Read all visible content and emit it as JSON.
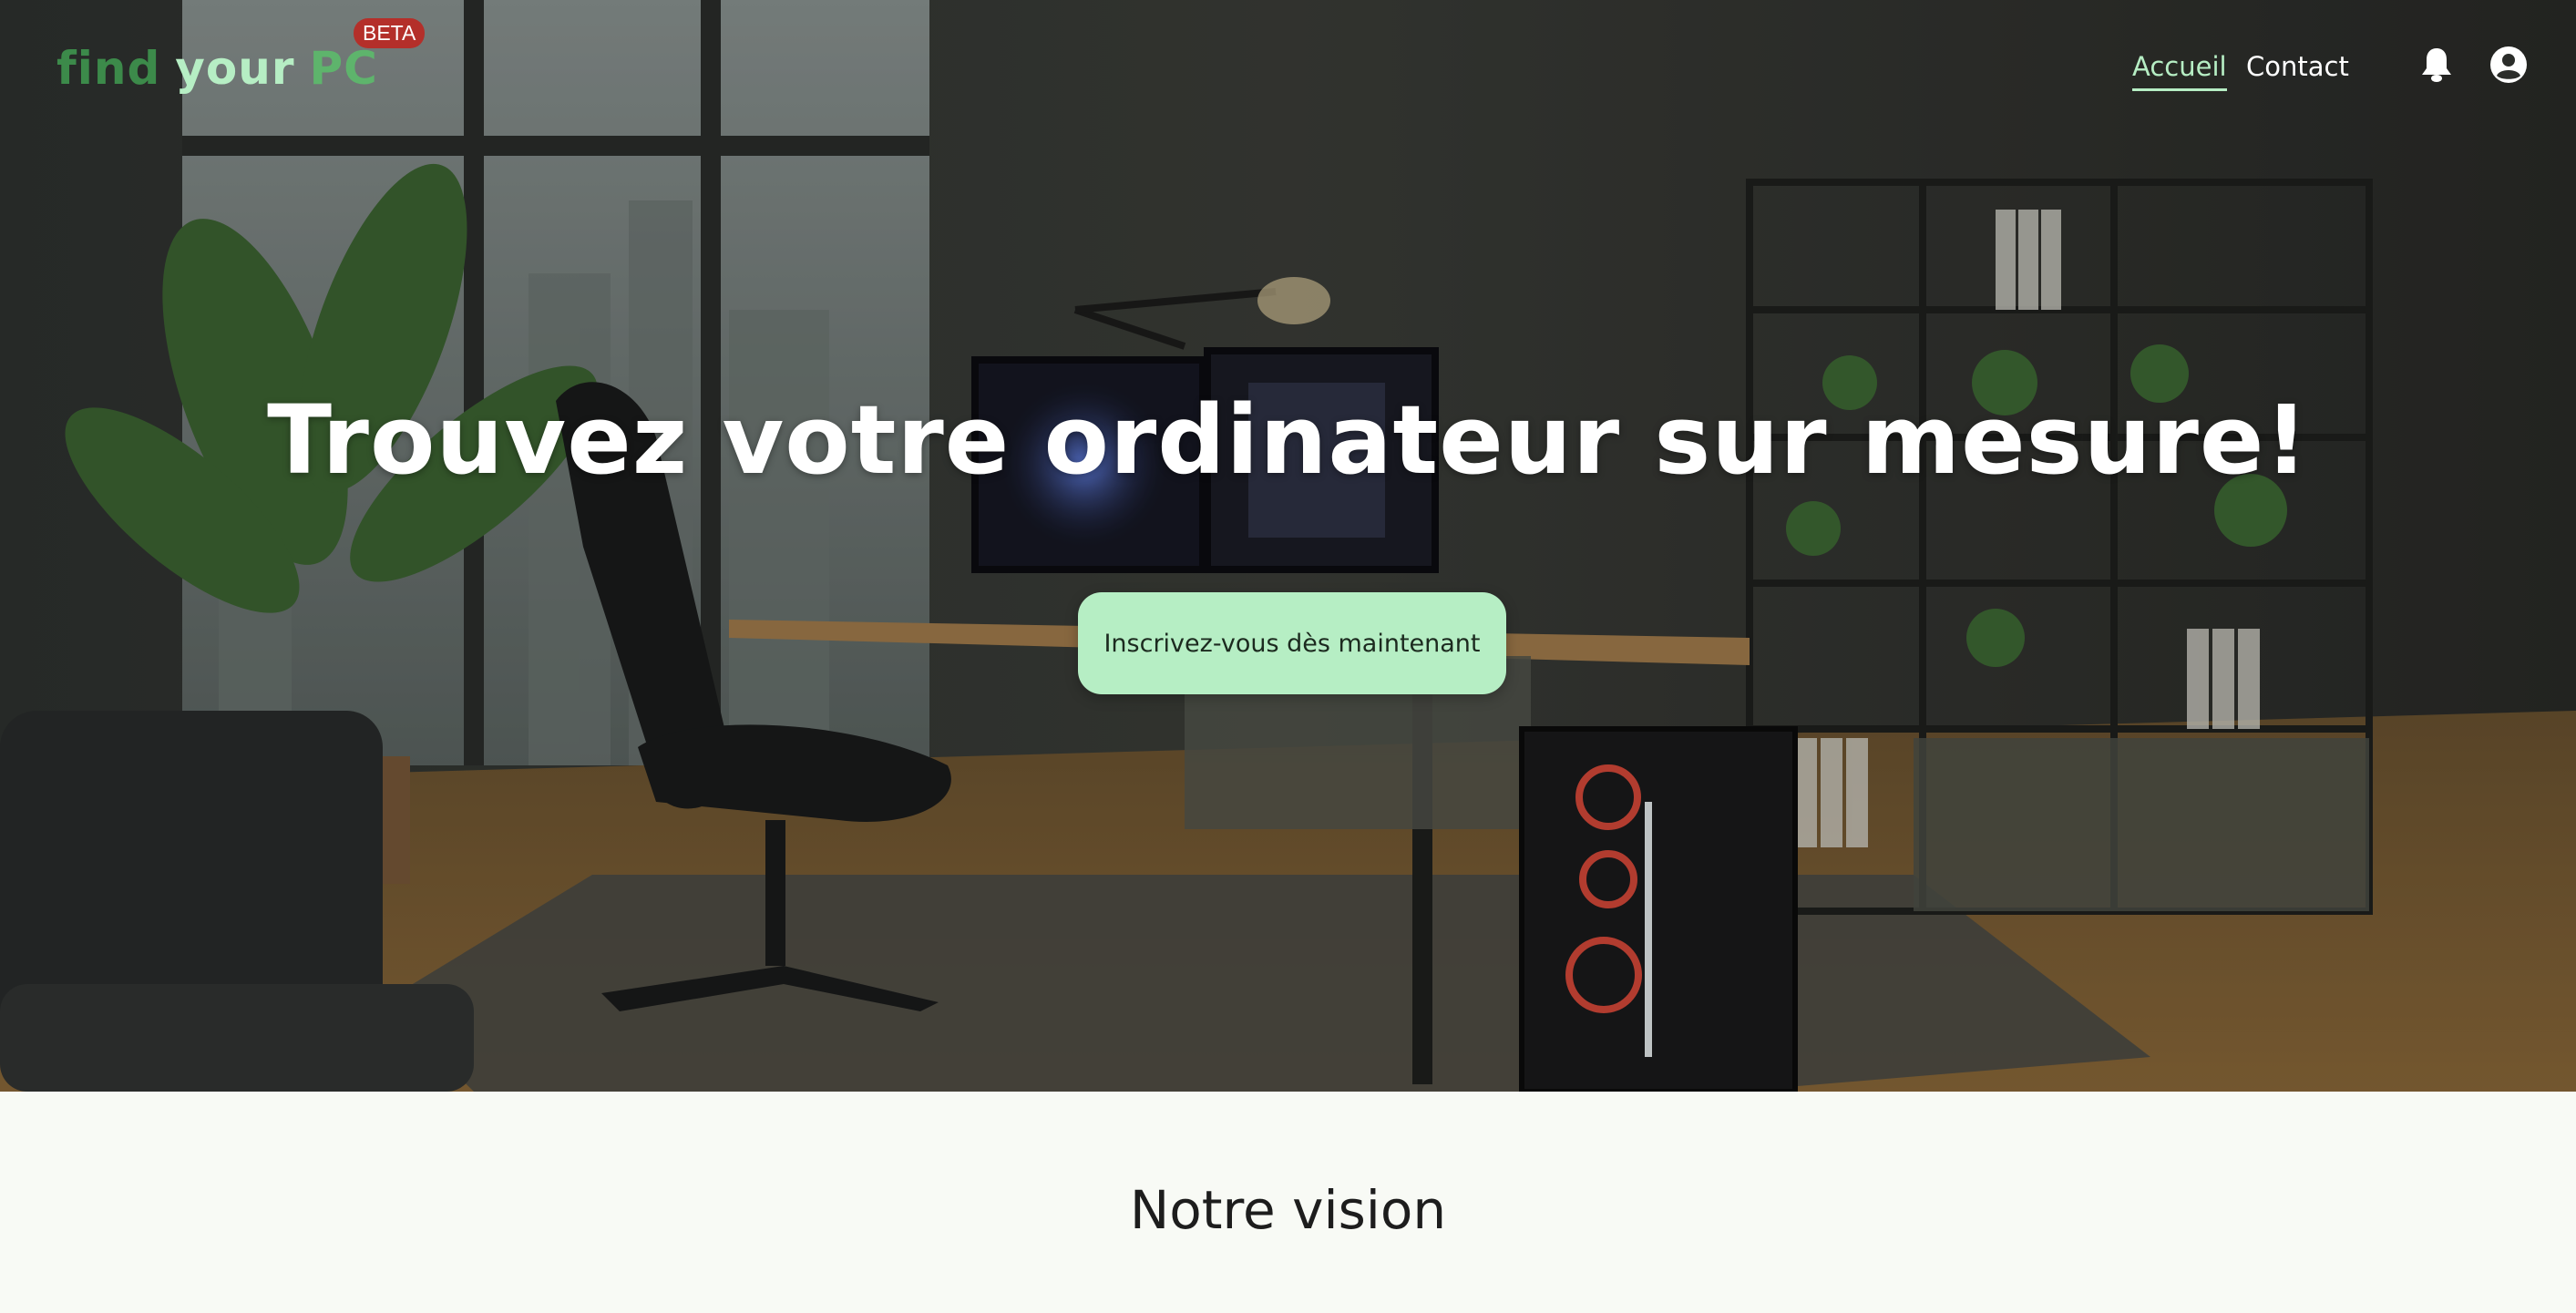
{
  "header": {
    "logo": {
      "part1": "find",
      "part2": "your",
      "part3": "PC"
    },
    "beta_badge": "BETA",
    "nav": [
      {
        "label": "Accueil",
        "active": true
      },
      {
        "label": "Contact",
        "active": false
      }
    ],
    "icons": [
      "bell-icon",
      "user-account-icon"
    ]
  },
  "hero": {
    "title": "Trouvez votre ordinateur sur mesure!",
    "cta_label": "Inscrivez-vous dès maintenant",
    "background_description_icon": "office-desk-photo"
  },
  "vision": {
    "title": "Notre vision"
  },
  "colors": {
    "accent_green": "#b6eec4",
    "logo_dark_green": "#3c8a4a",
    "beta_red": "#b42f2a",
    "page_bg": "#f8faf5"
  }
}
